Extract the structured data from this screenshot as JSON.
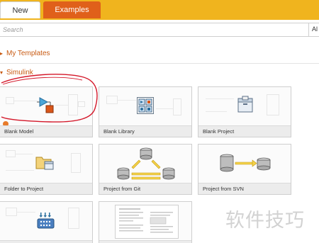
{
  "tabs": {
    "new_label": "New",
    "examples_label": "Examples"
  },
  "search": {
    "placeholder": "Search",
    "scope_label": "Al"
  },
  "sections": {
    "templates_label": "My Templates",
    "simulink_label": "Simulink"
  },
  "cards": [
    {
      "label": "Blank Model",
      "icon": "blank-model-icon"
    },
    {
      "label": "Blank Library",
      "icon": "blank-library-icon"
    },
    {
      "label": "Blank Project",
      "icon": "blank-project-icon"
    },
    {
      "label": "Folder to Project",
      "icon": "folder-to-project-icon"
    },
    {
      "label": "Project from Git",
      "icon": "git-project-icon"
    },
    {
      "label": "Project from SVN",
      "icon": "svn-project-icon"
    },
    {
      "label": "",
      "icon": "code-generation-icon"
    },
    {
      "label": "",
      "icon": "document-template-icon"
    }
  ],
  "watermark": "软件技巧",
  "colors": {
    "tabbar": "#f0b41e",
    "examples_tab": "#e0601a",
    "section_header": "#c85a12",
    "annotation": "#d4182a"
  }
}
